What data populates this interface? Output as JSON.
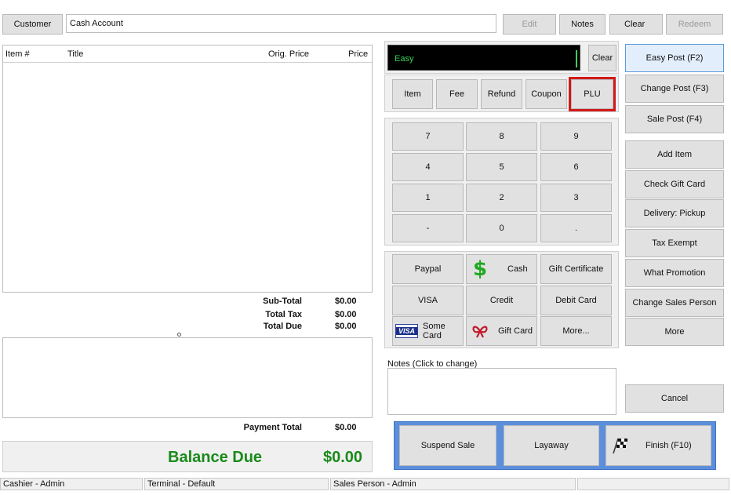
{
  "top": {
    "customer_label": "Customer",
    "account_value": "Cash Account",
    "edit_label": "Edit",
    "notes_label": "Notes",
    "clear_label": "Clear",
    "redeem_label": "Redeem"
  },
  "items_table": {
    "columns": [
      "Item #",
      "Title",
      "Orig. Price",
      "Price"
    ]
  },
  "totals": {
    "subtotal_label": "Sub-Total",
    "subtotal_value": "$0.00",
    "tax_label": "Total Tax",
    "tax_value": "$0.00",
    "due_label": "Total Due",
    "due_value": "$0.00",
    "payment_total_label": "Payment Total",
    "payment_total_value": "$0.00",
    "balance_label": "Balance Due",
    "balance_value": "$0.00"
  },
  "entry": {
    "display_value": "Easy",
    "clear_label": "Clear"
  },
  "mode_buttons": [
    "Item",
    "Fee",
    "Refund",
    "Coupon",
    "PLU"
  ],
  "keypad": [
    "7",
    "8",
    "9",
    "4",
    "5",
    "6",
    "1",
    "2",
    "3",
    "-",
    "0",
    "."
  ],
  "payments": {
    "paypal": "Paypal",
    "cash": "Cash",
    "gift_certificate": "Gift Certificate",
    "visa": "VISA",
    "credit": "Credit",
    "debit_card": "Debit Card",
    "some_card": "Some Card",
    "gift_card": "Gift Card",
    "more": "More...",
    "visa_icon_text": "VISA"
  },
  "notes": {
    "label": "Notes (Click to change)"
  },
  "bottom_actions": {
    "suspend": "Suspend Sale",
    "layaway": "Layaway",
    "finish": "Finish (F10)"
  },
  "right_panel": {
    "easy_post": "Easy Post (F2)",
    "change_post": "Change Post (F3)",
    "sale_post": "Sale Post (F4)",
    "add_item": "Add Item",
    "check_gift_card": "Check Gift Card",
    "delivery": "Delivery: Pickup",
    "tax_exempt": "Tax Exempt",
    "what_promotion": "What Promotion",
    "change_sales_person": "Change Sales Person",
    "more": "More",
    "cancel": "Cancel"
  },
  "status_bar": {
    "cashier": "Cashier - Admin",
    "terminal": "Terminal - Default",
    "sales_person": "Sales Person - Admin"
  },
  "colors": {
    "balance_green": "#1a8a1a",
    "highlight_red": "#d11a1a",
    "blue_border": "#5a9bdc",
    "display_bg": "#000000"
  },
  "icons": {
    "cash": "dollar-icon",
    "visa": "visa-card-icon",
    "gift": "gift-ribbon-icon",
    "finish": "checkered-flag-icon"
  }
}
